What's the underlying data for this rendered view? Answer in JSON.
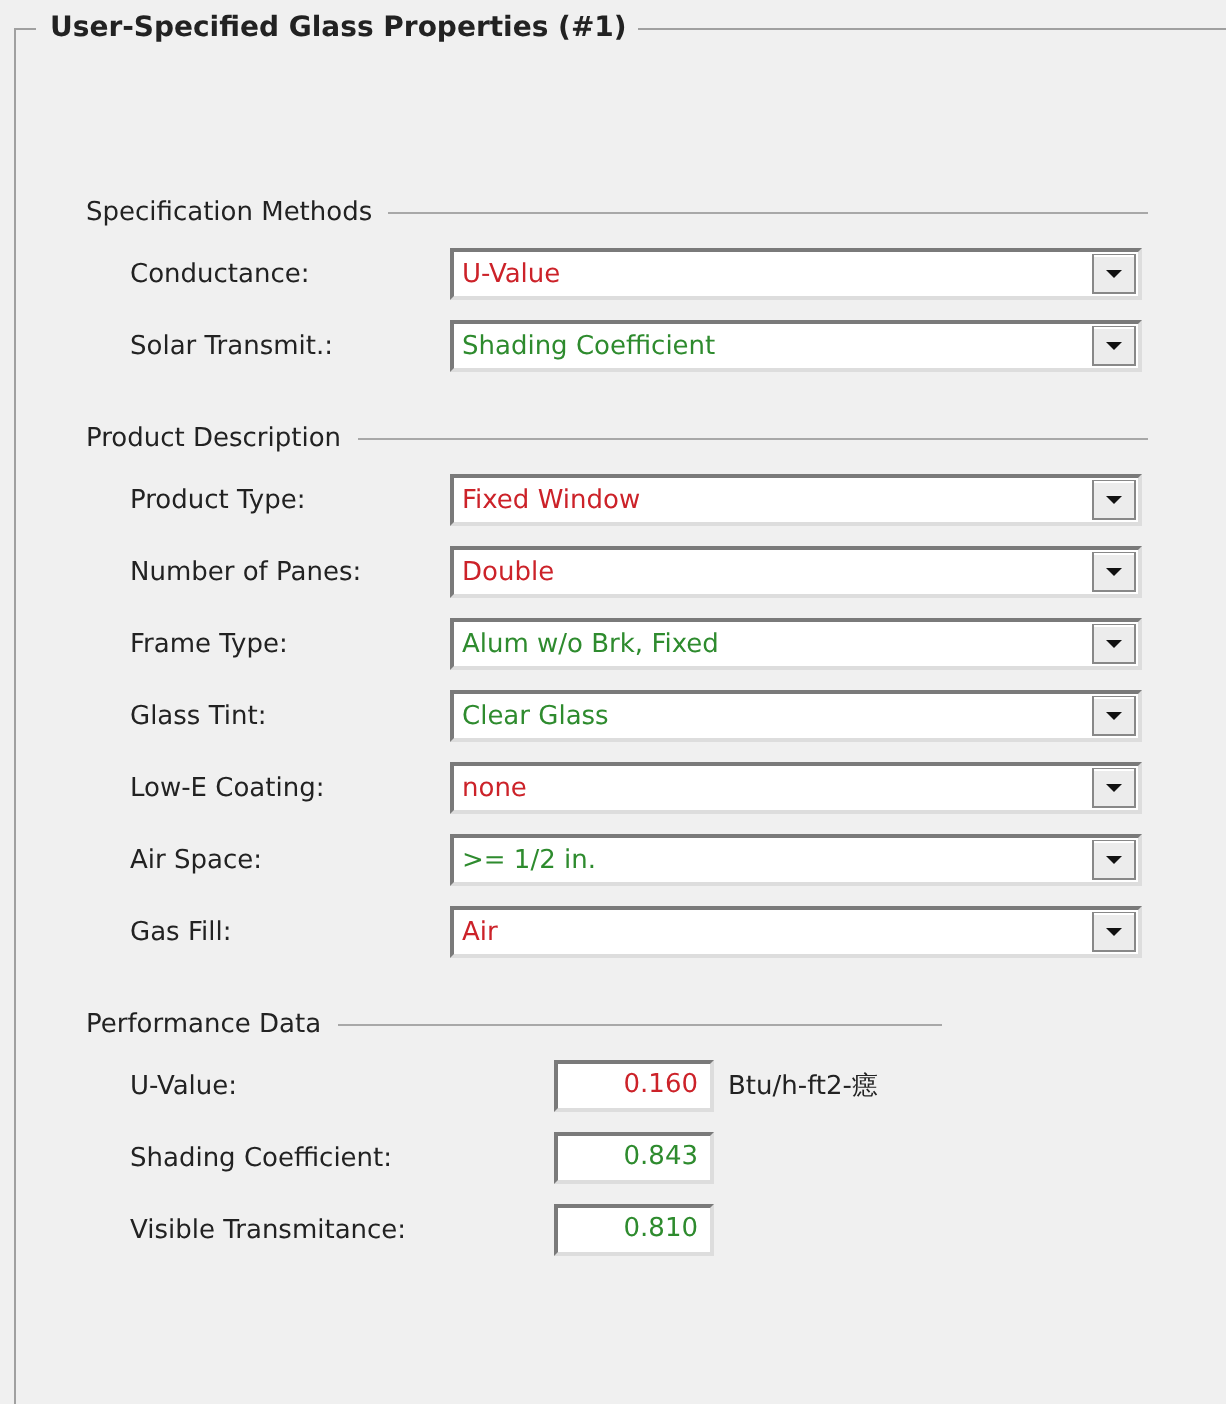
{
  "group_title": "User-Specified Glass Properties (#1)",
  "sections": [
    {
      "title": "Specification Methods",
      "kind": "dropdowns",
      "fields": [
        {
          "label": "Conductance:",
          "value": "U-Value",
          "color": "#cc2229"
        },
        {
          "label": "Solar Transmit.:",
          "value": "Shading Coefficient",
          "color": "#2e8b2e"
        }
      ]
    },
    {
      "title": "Product Description",
      "kind": "dropdowns",
      "fields": [
        {
          "label": "Product Type:",
          "value": "Fixed Window",
          "color": "#cc2229"
        },
        {
          "label": "Number of Panes:",
          "value": "Double",
          "color": "#cc2229"
        },
        {
          "label": "Frame Type:",
          "value": "Alum w/o Brk, Fixed",
          "color": "#2e8b2e"
        },
        {
          "label": "Glass Tint:",
          "value": "Clear Glass",
          "color": "#2e8b2e"
        },
        {
          "label": "Low-E Coating:",
          "value": "none",
          "color": "#cc2229"
        },
        {
          "label": "Air Space:",
          "value": ">= 1/2 in.",
          "color": "#2e8b2e"
        },
        {
          "label": "Gas Fill:",
          "value": "Air",
          "color": "#cc2229"
        }
      ]
    },
    {
      "title": "Performance Data",
      "kind": "numbers",
      "fields": [
        {
          "label": "U-Value:",
          "value": "0.160",
          "color": "#cc2229",
          "unit": "Btu/h-ft2-癋"
        },
        {
          "label": "Shading Coefficient:",
          "value": "0.843",
          "color": "#2e8b2e"
        },
        {
          "label": "Visible Transmitance:",
          "value": "0.810",
          "color": "#2e8b2e"
        }
      ]
    }
  ]
}
